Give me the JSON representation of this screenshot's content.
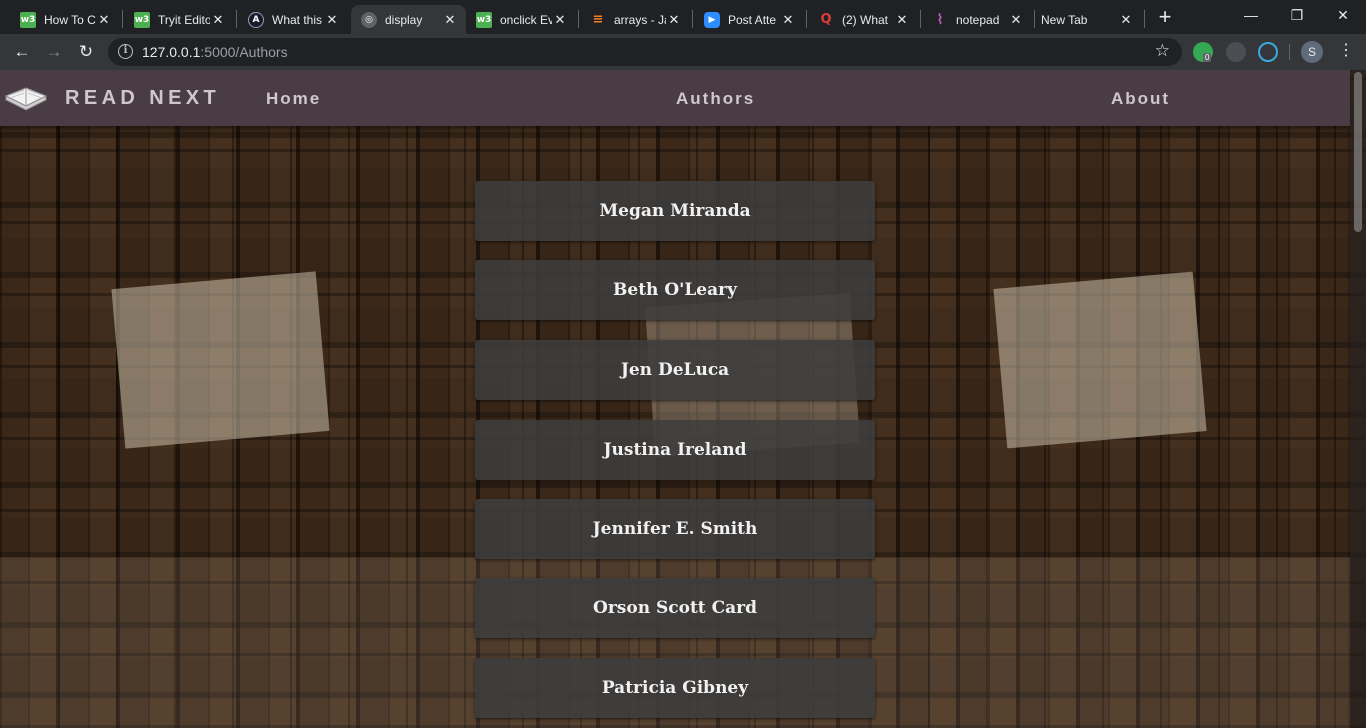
{
  "browser": {
    "tabs": [
      {
        "title": "How To C",
        "favicon": "w3schools-icon",
        "color": "#4caf50",
        "glyph": "w3"
      },
      {
        "title": "Tryit Edito",
        "favicon": "w3schools-icon",
        "color": "#4caf50",
        "glyph": "w3"
      },
      {
        "title": "What this",
        "favicon": "angular-icon",
        "color": "#1a1a2e",
        "glyph": "A"
      },
      {
        "title": "display",
        "favicon": "globe-icon",
        "color": "#5f6368",
        "glyph": "◎"
      },
      {
        "title": "onclick Ev",
        "favicon": "w3schools-icon",
        "color": "#4caf50",
        "glyph": "w3"
      },
      {
        "title": "arrays - Ja",
        "favicon": "stackoverflow-icon",
        "color": "#f48024",
        "glyph": "≡"
      },
      {
        "title": "Post Atte",
        "favicon": "zoom-icon",
        "color": "#2d8cff",
        "glyph": "▶"
      },
      {
        "title": "(2) What",
        "favicon": "quora-icon",
        "color": "#b92b27",
        "glyph": "Q"
      },
      {
        "title": "notepad",
        "favicon": "notepad-icon",
        "color": "#b04bb4",
        "glyph": "⌇"
      },
      {
        "title": "New Tab",
        "favicon": "",
        "color": "",
        "glyph": ""
      }
    ],
    "active_tab_index": 3,
    "url_host": "127.0.0.1",
    "url_path": ":5000/Authors",
    "profile_initial": "S",
    "extension_badge": "0"
  },
  "site": {
    "brand": "READ NEXT",
    "nav": [
      "Home",
      "Authors",
      "About"
    ]
  },
  "authors": [
    "Megan Miranda",
    "Beth O'Leary",
    "Jen DeLuca",
    "Justina Ireland",
    "Jennifer E. Smith",
    "Orson Scott Card",
    "Patricia Gibney"
  ]
}
